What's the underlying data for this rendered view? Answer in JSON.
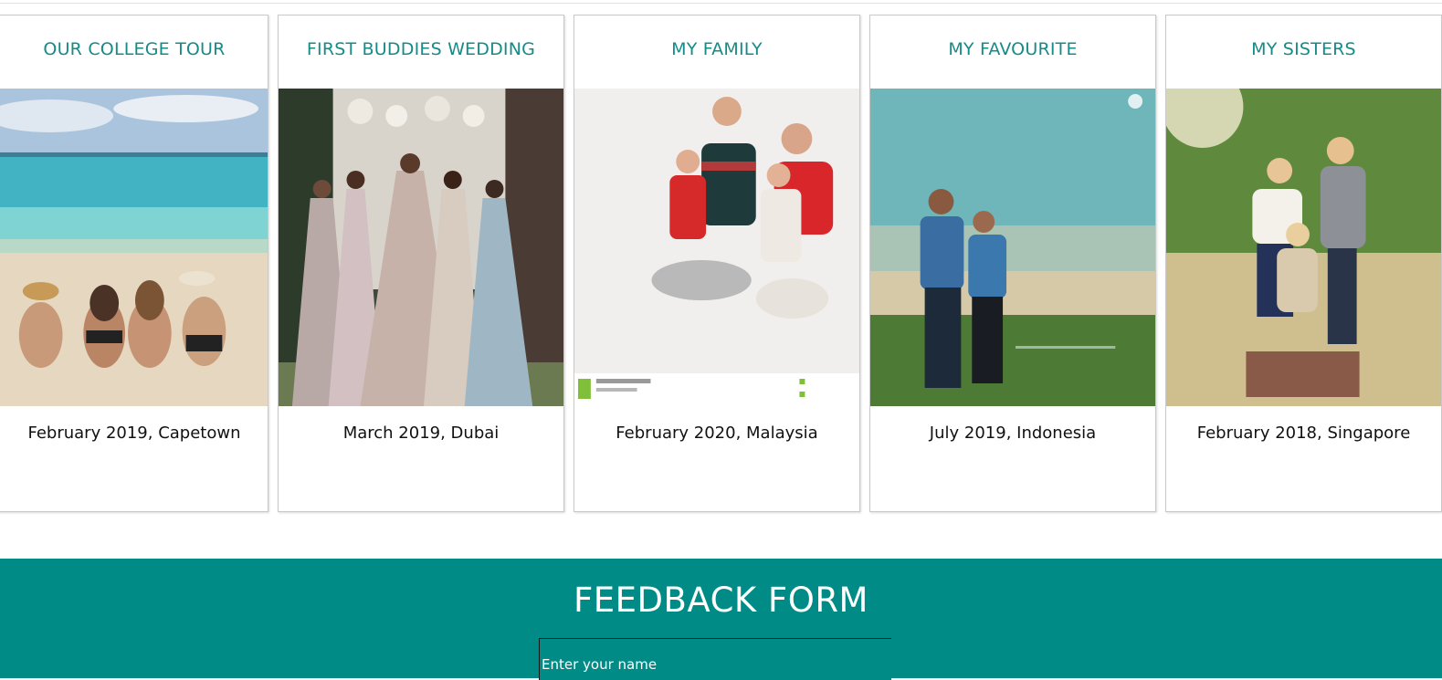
{
  "gallery": {
    "cards": [
      {
        "title": "OUR COLLEGE TOUR",
        "caption": "February 2019, Capetown",
        "photo": "beach-friends-photo"
      },
      {
        "title": "FIRST BUDDIES WEDDING",
        "caption": "March 2019, Dubai",
        "photo": "wedding-bridesmaids-photo"
      },
      {
        "title": "MY FAMILY",
        "caption": "February 2020, Malaysia",
        "photo": "family-studio-photo"
      },
      {
        "title": "MY FAVOURITE",
        "caption": "July 2019, Indonesia",
        "photo": "couple-field-photo"
      },
      {
        "title": "MY SISTERS",
        "caption": "February 2018, Singapore",
        "photo": "sisters-outdoor-photo"
      }
    ]
  },
  "feedback": {
    "title": "FEEDBACK FORM",
    "name_placeholder": "Enter your name"
  },
  "colors": {
    "accent": "#008b87",
    "title_text": "#168b87"
  }
}
